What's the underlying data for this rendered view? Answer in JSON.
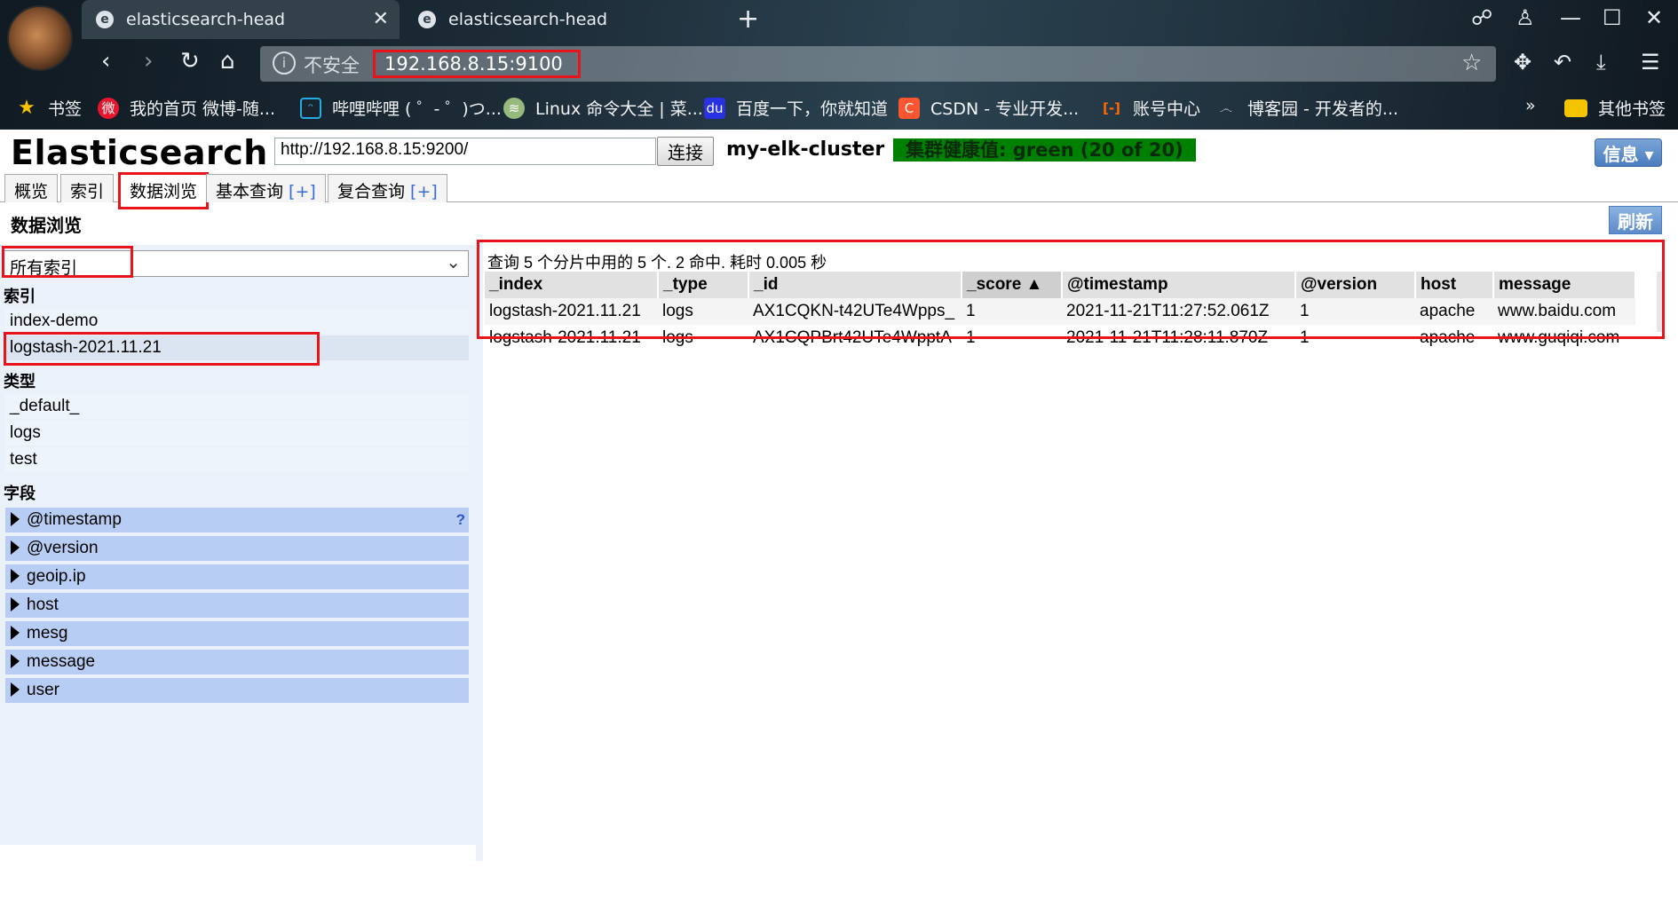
{
  "browser": {
    "tabs": [
      {
        "title": "elasticsearch-head",
        "active": true
      },
      {
        "title": "elasticsearch-head",
        "active": false
      }
    ],
    "new_tab": "+",
    "url_security": "不安全",
    "url": "192.168.8.15:9100",
    "bookmarks": [
      {
        "label": "书签",
        "icon": "star-icon"
      },
      {
        "label": "我的首页 微博-随...",
        "icon": "weibo-icon"
      },
      {
        "label": "哔哩哔哩 ( ゜- ゜)つ...",
        "icon": "bilibili-icon"
      },
      {
        "label": "Linux 命令大全 | 菜...",
        "icon": "runoob-icon"
      },
      {
        "label": "百度一下，你就知道",
        "icon": "baidu-icon"
      },
      {
        "label": "CSDN - 专业开发...",
        "icon": "csdn-icon"
      },
      {
        "label": "账号中心",
        "icon": "aliyun-icon"
      },
      {
        "label": "博客园 - 开发者的...",
        "icon": "cnblogs-icon"
      }
    ],
    "bookmarks_more": "»",
    "other_bookmarks": "其他书签"
  },
  "app": {
    "title": "Elasticsearch",
    "connect_url": "http://192.168.8.15:9200/",
    "connect_label": "连接",
    "cluster_name": "my-elk-cluster",
    "cluster_health": "集群健康值: green (20 of 20)",
    "info_label": "信息 ▾",
    "tabs": [
      {
        "label": "概览",
        "plus": ""
      },
      {
        "label": "索引",
        "plus": ""
      },
      {
        "label": "数据浏览",
        "plus": ""
      },
      {
        "label": "基本查询 ",
        "plus": "[+]"
      },
      {
        "label": "复合查询 ",
        "plus": "[+]"
      }
    ],
    "active_tab": 2
  },
  "browse": {
    "title": "数据浏览",
    "refresh_label": "刷新",
    "index_select": "所有索引",
    "indices_heading": "索引",
    "indices": [
      "index-demo",
      "logstash-2021.11.21"
    ],
    "selected_index": 1,
    "types_heading": "类型",
    "types": [
      "_default_",
      "logs",
      "test"
    ],
    "fields_heading": "字段",
    "fields": [
      "@timestamp",
      "@version",
      "geoip.ip",
      "host",
      "mesg",
      "message",
      "user"
    ],
    "field_help": "?"
  },
  "results": {
    "summary": "查询 5 个分片中用的 5 个. 2 命中. 耗时 0.005 秒",
    "columns": [
      "_index",
      "_type",
      "_id",
      "_score ▲",
      "@timestamp",
      "@version",
      "host",
      "message"
    ],
    "rows": [
      [
        "logstash-2021.11.21",
        "logs",
        "AX1CQKN-t42UTe4Wpps_",
        "1",
        "2021-11-21T11:27:52.061Z",
        "1",
        "apache",
        "www.baidu.com"
      ],
      [
        "logstash-2021.11.21",
        "logs",
        "AX1CQPBrt42UTe4WpptA",
        "1",
        "2021-11-21T11:28:11.870Z",
        "1",
        "apache",
        "www.guqiqi.com"
      ]
    ]
  },
  "colors": {
    "health_green": "#008000",
    "highlight_red": "#e8141c",
    "field_blue": "#b8cdf4"
  }
}
